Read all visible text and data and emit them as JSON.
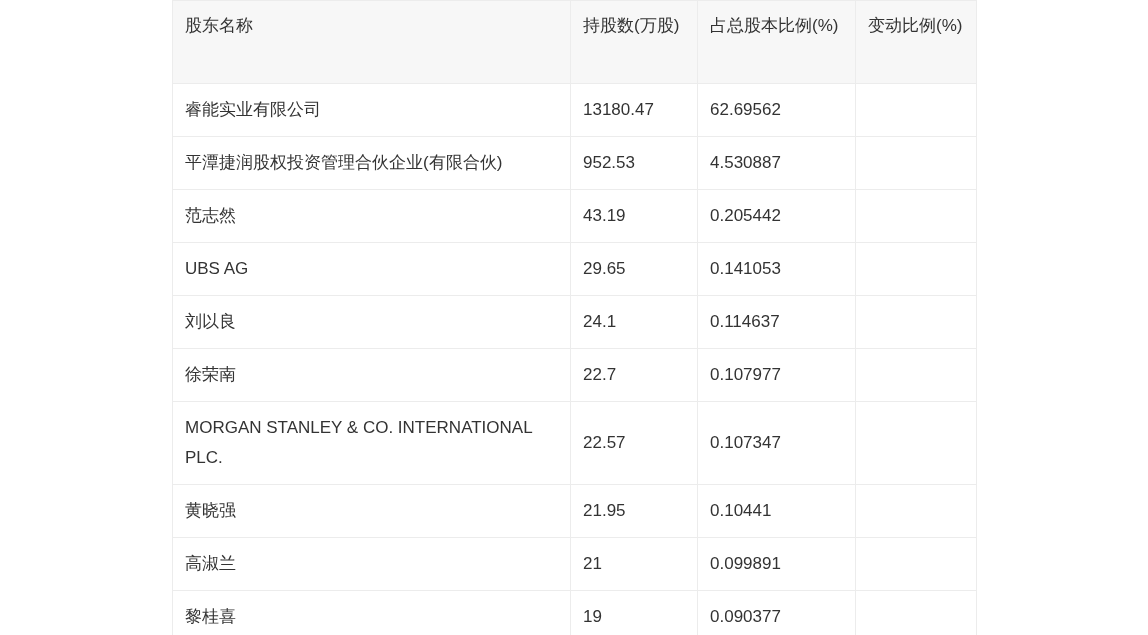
{
  "table": {
    "columns": [
      "股东名称",
      "持股数(万股)",
      "占总股本比例(%)",
      "变动比例(%)"
    ],
    "rows": [
      [
        "睿能实业有限公司",
        "13180.47",
        "62.69562",
        ""
      ],
      [
        "平潭捷润股权投资管理合伙企业(有限合伙)",
        "952.53",
        "4.530887",
        ""
      ],
      [
        "范志然",
        "43.19",
        "0.205442",
        ""
      ],
      [
        "UBS AG",
        "29.65",
        "0.141053",
        ""
      ],
      [
        "刘以良",
        "24.1",
        "0.114637",
        ""
      ],
      [
        "徐荣南",
        "22.7",
        "0.107977",
        ""
      ],
      [
        "MORGAN STANLEY & CO. INTERNATIONAL PLC.",
        "22.57",
        "0.107347",
        ""
      ],
      [
        "黄晓强",
        "21.95",
        "0.10441",
        ""
      ],
      [
        "高淑兰",
        "21",
        "0.099891",
        ""
      ],
      [
        "黎桂喜",
        "19",
        "0.090377",
        ""
      ]
    ]
  }
}
